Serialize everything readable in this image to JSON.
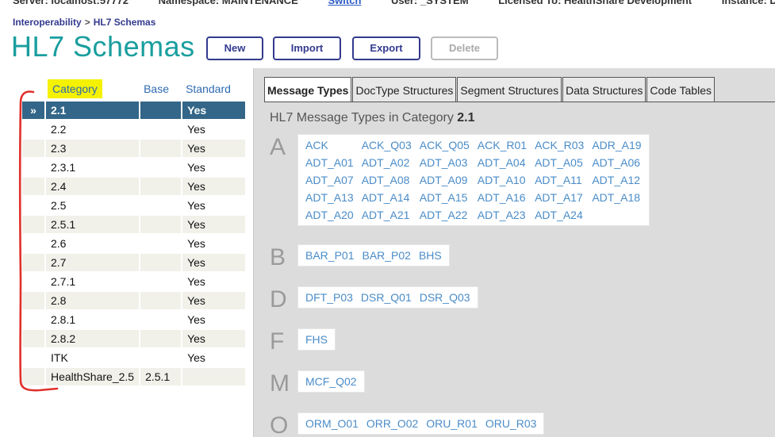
{
  "topbar": {
    "items": [
      "Server: localhost:57772",
      "Namespace: MAINTENANCE",
      "Switch",
      "User: _SYSTEM",
      "Licensed To: HealthShare Development",
      "Instance: DEV"
    ]
  },
  "breadcrumb": {
    "root": "Interoperability",
    "separator": ">",
    "current": "HL7 Schemas"
  },
  "page": {
    "title": "HL7 Schemas"
  },
  "toolbar": {
    "new_label": "New",
    "import_label": "Import",
    "export_label": "Export",
    "delete_label": "Delete"
  },
  "categories": {
    "headers": {
      "category": "Category",
      "base": "Base",
      "standard": "Standard"
    },
    "selected_marker": "»",
    "rows": [
      {
        "category": "2.1",
        "base": "",
        "standard": "Yes"
      },
      {
        "category": "2.2",
        "base": "",
        "standard": "Yes"
      },
      {
        "category": "2.3",
        "base": "",
        "standard": "Yes"
      },
      {
        "category": "2.3.1",
        "base": "",
        "standard": "Yes"
      },
      {
        "category": "2.4",
        "base": "",
        "standard": "Yes"
      },
      {
        "category": "2.5",
        "base": "",
        "standard": "Yes"
      },
      {
        "category": "2.5.1",
        "base": "",
        "standard": "Yes"
      },
      {
        "category": "2.6",
        "base": "",
        "standard": "Yes"
      },
      {
        "category": "2.7",
        "base": "",
        "standard": "Yes"
      },
      {
        "category": "2.7.1",
        "base": "",
        "standard": "Yes"
      },
      {
        "category": "2.8",
        "base": "",
        "standard": "Yes"
      },
      {
        "category": "2.8.1",
        "base": "",
        "standard": "Yes"
      },
      {
        "category": "2.8.2",
        "base": "",
        "standard": "Yes"
      },
      {
        "category": "ITK",
        "base": "",
        "standard": "Yes"
      },
      {
        "category": "HealthShare_2.5",
        "base": "2.5.1",
        "standard": ""
      }
    ]
  },
  "tabs": [
    "Message Types",
    "DocType Structures",
    "Segment Structures",
    "Data Structures",
    "Code Tables"
  ],
  "message_types": {
    "heading_prefix": "HL7 Message Types in Category",
    "category": "2.1",
    "groups": [
      {
        "letter": "A",
        "items": [
          "ACK",
          "ACK_Q03",
          "ACK_Q05",
          "ACK_R01",
          "ACK_R03",
          "ADR_A19",
          "ADT_A01",
          "ADT_A02",
          "ADT_A03",
          "ADT_A04",
          "ADT_A05",
          "ADT_A06",
          "ADT_A07",
          "ADT_A08",
          "ADT_A09",
          "ADT_A10",
          "ADT_A11",
          "ADT_A12",
          "ADT_A13",
          "ADT_A14",
          "ADT_A15",
          "ADT_A16",
          "ADT_A17",
          "ADT_A18",
          "ADT_A20",
          "ADT_A21",
          "ADT_A22",
          "ADT_A23",
          "ADT_A24"
        ]
      },
      {
        "letter": "B",
        "items": [
          "BAR_P01",
          "BAR_P02",
          "BHS"
        ]
      },
      {
        "letter": "D",
        "items": [
          "DFT_P03",
          "DSR_Q01",
          "DSR_Q03"
        ]
      },
      {
        "letter": "F",
        "items": [
          "FHS"
        ]
      },
      {
        "letter": "M",
        "items": [
          "MCF_Q02"
        ]
      },
      {
        "letter": "O",
        "items": [
          "ORM_O01",
          "ORR_O02",
          "ORU_R01",
          "ORU_R03"
        ]
      }
    ]
  },
  "colors": {
    "accent": "#1a9e9e",
    "selected_row": "#336688",
    "link": "#4a8cc8",
    "highlight": "#f4f200",
    "annotation": "#e0302a"
  }
}
